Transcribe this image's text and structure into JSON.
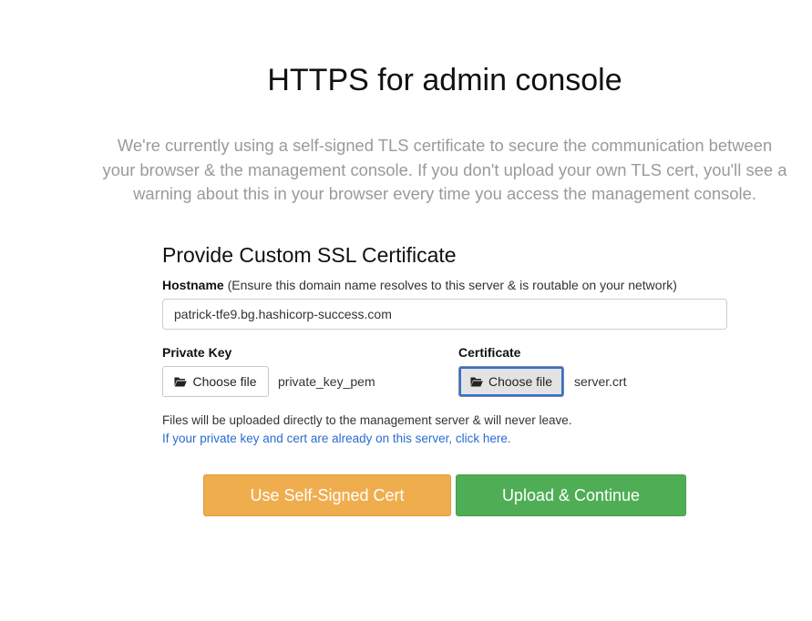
{
  "header": {
    "title": "HTTPS for admin console",
    "intro": "We're currently using a self-signed TLS certificate to secure the communication between your browser & the management console. If you don't upload your own TLS cert, you'll see a warning about this in your browser every time you access the management console."
  },
  "form": {
    "section_title": "Provide Custom SSL Certificate",
    "hostname": {
      "label": "Hostname",
      "hint": "(Ensure this domain name resolves to this server & is routable on your network)",
      "value": "patrick-tfe9.bg.hashicorp-success.com"
    },
    "private_key": {
      "label": "Private Key",
      "button_label": "Choose file",
      "button_icon": "folder-open-icon",
      "file_name": "private_key_pem"
    },
    "certificate": {
      "label": "Certificate",
      "button_label": "Choose file",
      "button_icon": "folder-open-icon",
      "file_name": "server.crt"
    },
    "note": "Files will be uploaded directly to the management server & will never leave.",
    "link": "If your private key and cert are already on this server, click here."
  },
  "actions": {
    "self_signed_label": "Use Self-Signed Cert",
    "upload_label": "Upload & Continue"
  },
  "colors": {
    "warning_button": "#f0ad4e",
    "success_button": "#4fae55",
    "link": "#2a6ccf",
    "muted_text": "#9a9a9a",
    "focus_ring": "#2f6fd6"
  }
}
